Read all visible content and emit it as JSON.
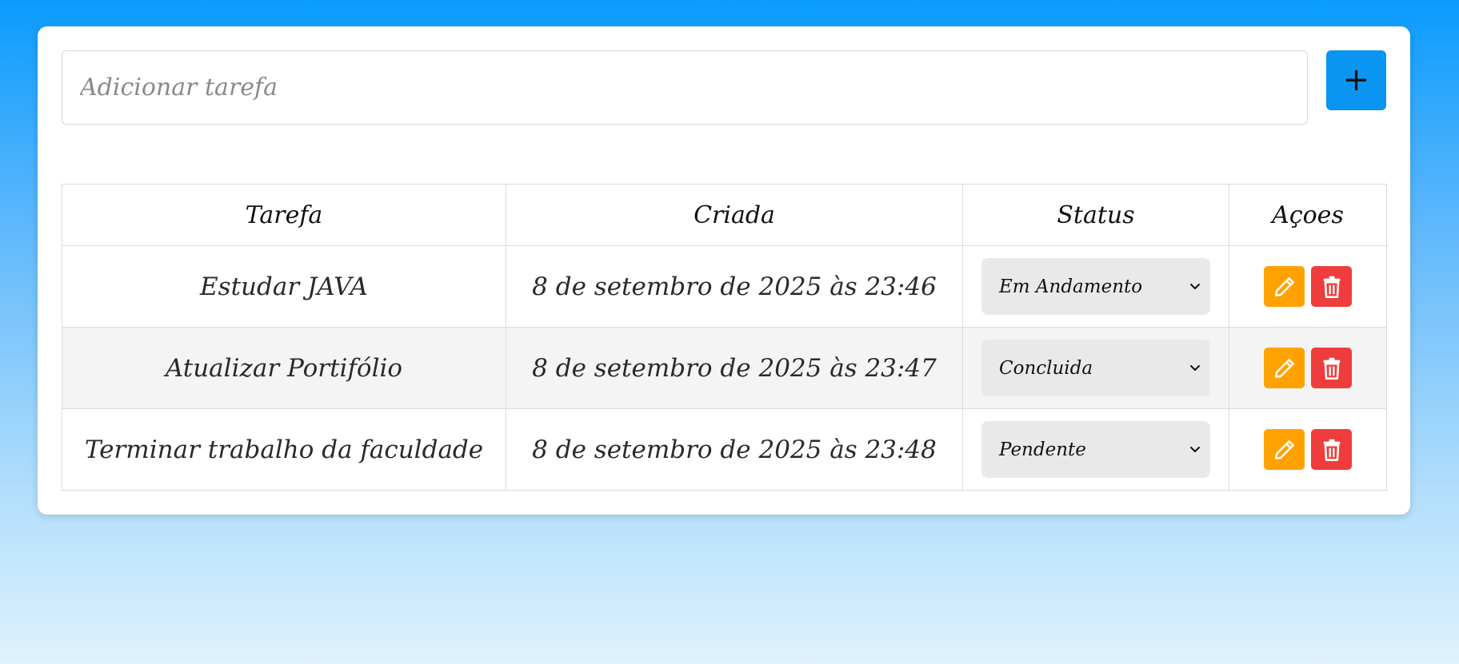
{
  "add_task": {
    "placeholder": "Adicionar tarefa",
    "add_label": "+"
  },
  "table": {
    "headers": {
      "task": "Tarefa",
      "created": "Criada",
      "status": "Status",
      "actions": "Açoes"
    },
    "rows": [
      {
        "task": "Estudar JAVA",
        "created": "8 de setembro de 2025 às 23:46",
        "status": "Em Andamento"
      },
      {
        "task": "Atualizar Portifólio",
        "created": "8 de setembro de 2025 às 23:47",
        "status": "Concluida"
      },
      {
        "task": "Terminar trabalho da faculdade",
        "created": "8 de setembro de 2025 às 23:48",
        "status": "Pendente"
      }
    ]
  },
  "icons": {
    "edit": "pencil-icon",
    "delete": "trash-icon",
    "dropdown": "chevron-down-icon"
  },
  "colors": {
    "primary": "#0a95f2",
    "edit": "#ffa200",
    "delete": "#ef3d3d",
    "select_bg": "#e9e9e9"
  }
}
